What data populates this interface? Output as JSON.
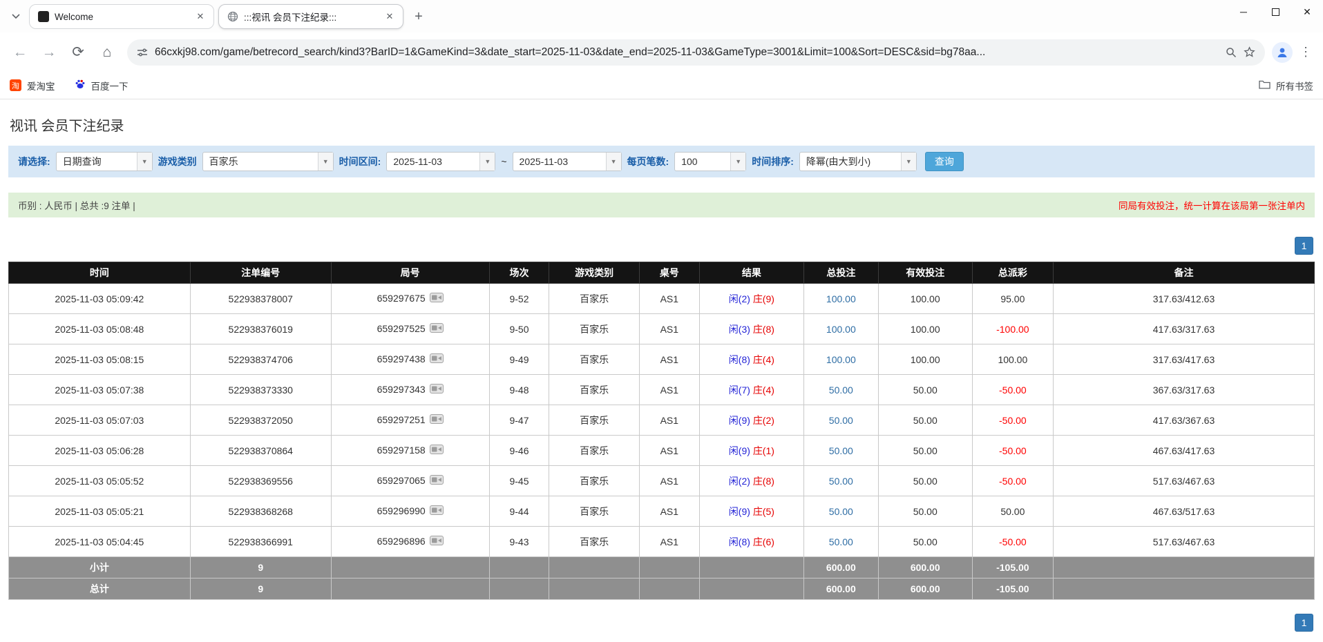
{
  "browser": {
    "tabs": [
      {
        "label": "Welcome"
      },
      {
        "label": ":::视讯 会员下注纪录:::"
      }
    ],
    "url": "66cxkj98.com/game/betrecord_search/kind3?BarID=1&GameKind=3&date_start=2025-11-03&date_end=2025-11-03&GameType=3001&Limit=100&Sort=DESC&sid=bg78aa...",
    "bookmarks": [
      {
        "label": "爱淘宝",
        "badge": "淘"
      },
      {
        "label": "百度一下"
      }
    ],
    "all_bookmarks": "所有书签"
  },
  "page": {
    "title": "视讯 会员下注纪录",
    "filters": {
      "select_label": "请选择:",
      "select_value": "日期查询",
      "game_type_label": "游戏类别",
      "game_type_value": "百家乐",
      "date_range_label": "时间区间:",
      "date_start": "2025-11-03",
      "date_separator": "~",
      "date_end": "2025-11-03",
      "page_size_label": "每页笔数:",
      "page_size_value": "100",
      "sort_label": "时间排序:",
      "sort_value": "降幂(由大到小)",
      "search_button": "查询"
    },
    "summary": {
      "left": "币别 : 人民币 | 总共 :9 注单 |",
      "right": "同局有效投注，统一计算在该局第一张注单内"
    },
    "pagination": {
      "page": "1"
    }
  },
  "table": {
    "headers": [
      "时间",
      "注单编号",
      "局号",
      "场次",
      "游戏类别",
      "桌号",
      "结果",
      "总投注",
      "有效投注",
      "总派彩",
      "备注"
    ],
    "rows": [
      {
        "time": "2025-11-03 05:09:42",
        "bet_id": "522938378007",
        "round_id": "659297675",
        "session": "9-52",
        "game": "百家乐",
        "table_no": "AS1",
        "result_player": "闲(2)",
        "result_banker": "庄(9)",
        "total_bet": "100.00",
        "valid_bet": "100.00",
        "payout": "95.00",
        "note": "317.63/412.63"
      },
      {
        "time": "2025-11-03 05:08:48",
        "bet_id": "522938376019",
        "round_id": "659297525",
        "session": "9-50",
        "game": "百家乐",
        "table_no": "AS1",
        "result_player": "闲(3)",
        "result_banker": "庄(8)",
        "total_bet": "100.00",
        "valid_bet": "100.00",
        "payout": "-100.00",
        "note": "417.63/317.63"
      },
      {
        "time": "2025-11-03 05:08:15",
        "bet_id": "522938374706",
        "round_id": "659297438",
        "session": "9-49",
        "game": "百家乐",
        "table_no": "AS1",
        "result_player": "闲(8)",
        "result_banker": "庄(4)",
        "total_bet": "100.00",
        "valid_bet": "100.00",
        "payout": "100.00",
        "note": "317.63/417.63"
      },
      {
        "time": "2025-11-03 05:07:38",
        "bet_id": "522938373330",
        "round_id": "659297343",
        "session": "9-48",
        "game": "百家乐",
        "table_no": "AS1",
        "result_player": "闲(7)",
        "result_banker": "庄(4)",
        "total_bet": "50.00",
        "valid_bet": "50.00",
        "payout": "-50.00",
        "note": "367.63/317.63"
      },
      {
        "time": "2025-11-03 05:07:03",
        "bet_id": "522938372050",
        "round_id": "659297251",
        "session": "9-47",
        "game": "百家乐",
        "table_no": "AS1",
        "result_player": "闲(9)",
        "result_banker": "庄(2)",
        "total_bet": "50.00",
        "valid_bet": "50.00",
        "payout": "-50.00",
        "note": "417.63/367.63"
      },
      {
        "time": "2025-11-03 05:06:28",
        "bet_id": "522938370864",
        "round_id": "659297158",
        "session": "9-46",
        "game": "百家乐",
        "table_no": "AS1",
        "result_player": "闲(9)",
        "result_banker": "庄(1)",
        "total_bet": "50.00",
        "valid_bet": "50.00",
        "payout": "-50.00",
        "note": "467.63/417.63"
      },
      {
        "time": "2025-11-03 05:05:52",
        "bet_id": "522938369556",
        "round_id": "659297065",
        "session": "9-45",
        "game": "百家乐",
        "table_no": "AS1",
        "result_player": "闲(2)",
        "result_banker": "庄(8)",
        "total_bet": "50.00",
        "valid_bet": "50.00",
        "payout": "-50.00",
        "note": "517.63/467.63"
      },
      {
        "time": "2025-11-03 05:05:21",
        "bet_id": "522938368268",
        "round_id": "659296990",
        "session": "9-44",
        "game": "百家乐",
        "table_no": "AS1",
        "result_player": "闲(9)",
        "result_banker": "庄(5)",
        "total_bet": "50.00",
        "valid_bet": "50.00",
        "payout": "50.00",
        "note": "467.63/517.63"
      },
      {
        "time": "2025-11-03 05:04:45",
        "bet_id": "522938366991",
        "round_id": "659296896",
        "session": "9-43",
        "game": "百家乐",
        "table_no": "AS1",
        "result_player": "闲(8)",
        "result_banker": "庄(6)",
        "total_bet": "50.00",
        "valid_bet": "50.00",
        "payout": "-50.00",
        "note": "517.63/467.63"
      }
    ],
    "subtotal": {
      "label": "小计",
      "count": "9",
      "total_bet": "600.00",
      "valid_bet": "600.00",
      "payout": "-105.00"
    },
    "total": {
      "label": "总计",
      "count": "9",
      "total_bet": "600.00",
      "valid_bet": "600.00",
      "payout": "-105.00"
    }
  }
}
